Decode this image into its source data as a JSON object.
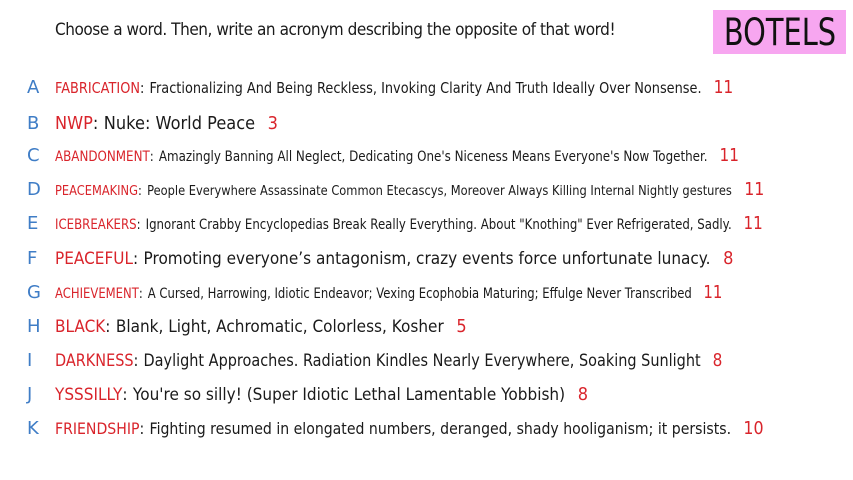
{
  "prompt": "Choose a word. Then, write an acronym describing the opposite of that word!",
  "logo": "BOTELS",
  "colors": {
    "letter": "#3f7dc6",
    "word": "#d9242b",
    "count": "#d9242b",
    "logo_bg": "#f7a6f0"
  },
  "entries": [
    {
      "letter": "A",
      "word": "FABRICATION",
      "acronym": "Fractionalizing And Being Reckless, Invoking Clarity And Truth Ideally Over Nonsense.",
      "count": "11"
    },
    {
      "letter": "B",
      "word": "NWP",
      "acronym": "Nuke: World Peace",
      "count": "3"
    },
    {
      "letter": "C",
      "word": "ABANDONMENT",
      "acronym": "Amazingly Banning All Neglect, Dedicating One's Niceness Means Everyone's Now Together.",
      "count": "11"
    },
    {
      "letter": "D",
      "word": "PEACEMAKING",
      "acronym": "People Everywhere Assassinate Common Etecascys, Moreover Always Killing Internal Nightly gestures",
      "count": "11"
    },
    {
      "letter": "E",
      "word": "ICEBREAKERS",
      "acronym": "Ignorant Crabby Encyclopedias Break Really Everything. About \"Knothing\" Ever Refrigerated, Sadly.",
      "count": "11"
    },
    {
      "letter": "F",
      "word": "PEACEFUL",
      "acronym": "Promoting everyone’s antagonism, crazy events force unfortunate lunacy.",
      "count": "8"
    },
    {
      "letter": "G",
      "word": "ACHIEVEMENT",
      "acronym": "A Cursed, Harrowing, Idiotic Endeavor; Vexing Ecophobia Maturing; Effulge Never Transcribed",
      "count": "11"
    },
    {
      "letter": "H",
      "word": "BLACK",
      "acronym": "Blank, Light, Achromatic, Colorless, Kosher",
      "count": "5"
    },
    {
      "letter": "I",
      "word": "DARKNESS",
      "acronym": "Daylight Approaches. Radiation Kindles Nearly Everywhere, Soaking Sunlight",
      "count": "8"
    },
    {
      "letter": "J",
      "word": "YSSSILLY",
      "acronym": "You're so silly! (Super Idiotic Lethal Lamentable Yobbish)",
      "count": "8"
    },
    {
      "letter": "K",
      "word": "FRIENDSHIP",
      "acronym": "Fighting resumed in elongated numbers, deranged, shady hooliganism; it persists.",
      "count": "10"
    }
  ]
}
